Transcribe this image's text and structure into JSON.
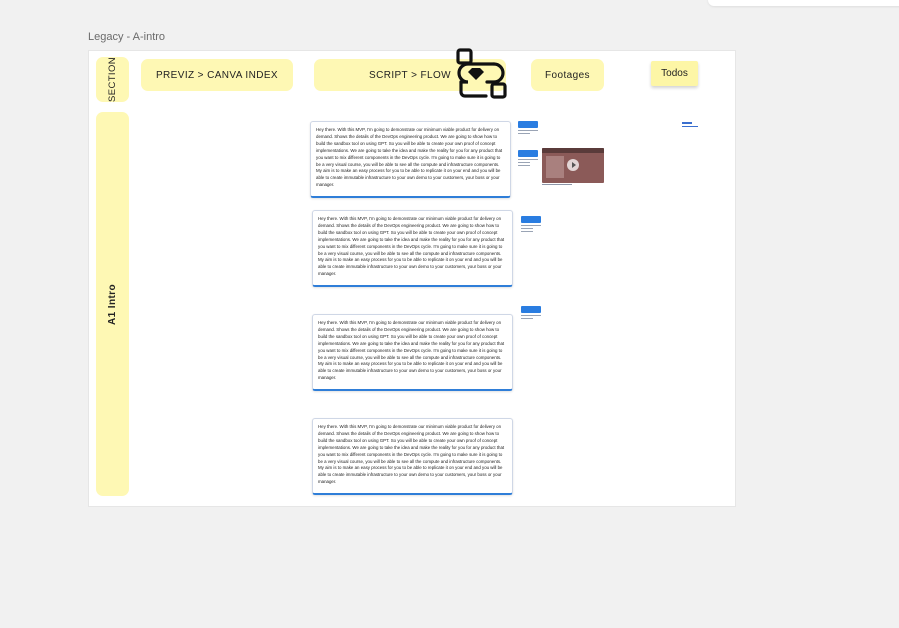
{
  "board": {
    "title": "Legacy - A-intro"
  },
  "columns": {
    "section": "SECTION",
    "previz": "PREVIZ > CANVA INDEX",
    "script": "SCRIPT > FLOW",
    "footages": "Footages",
    "todos": "Todos"
  },
  "rows": {
    "a1": "A1 Intro"
  },
  "script_cards": [
    {
      "text": "Hey there. With this MVP, I'm going to demonstrate our minimum viable product for delivery on demand. Shows the details of the DevOps engineering product. We are going to show how to build the sandbox tool on using GPT. So you will be able to create your own proof of concept implementations. We are going to take the idea and make the reality for you for any product that you want to mix different components in the DevOps cycle. I'm going to make sure it is going to be a very visual course, you will be able to see all the compute and infrastructure components. My aim is to make an easy process for you to be able to replicate it on your end and you will be able to create immutable infrastructure to your own demo to your customers, your boss or your manager."
    },
    {
      "text": "Hey there. With this MVP, I'm going to demonstrate our minimum viable product for delivery on demand. Shows the details of the DevOps engineering product. We are going to show how to build the sandbox tool on using GPT. So you will be able to create your own proof of concept implementations. We are going to take the idea and make the reality for you for any product that you want to mix different components in the DevOps cycle. I'm going to make sure it is going to be a very visual course, you will be able to see all the compute and infrastructure components. My aim is to make an easy process for you to be able to replicate it on your end and you will be able to create immutable infrastructure to your own demo to your customers, your boss or your manager."
    },
    {
      "text": "Hey there. With this MVP, I'm going to demonstrate our minimum viable product for delivery on demand. Shows the details of the DevOps engineering product. We are going to show how to build the sandbox tool on using GPT. So you will be able to create your own proof of concept implementations. We are going to take the idea and make the reality for you for any product that you want to mix different components in the DevOps cycle. I'm going to make sure it is going to be a very visual course, you will be able to see all the compute and infrastructure components. My aim is to make an easy process for you to be able to replicate it on your end and you will be able to create immutable infrastructure to your own demo to your customers, your boss or your manager."
    },
    {
      "text": "Hey there. With this MVP, I'm going to demonstrate our minimum viable product for delivery on demand. Shows the details of the DevOps engineering product. We are going to show how to build the sandbox tool on using GPT. So you will be able to create your own proof of concept implementations. We are going to take the idea and make the reality for you for any product that you want to mix different components in the DevOps cycle. I'm going to make sure it is going to be a very visual course, you will be able to see all the compute and infrastructure components. My aim is to make an easy process for you to be able to replicate it on your end and you will be able to create immutable infrastructure to your own demo to your customers, your boss or your manager."
    }
  ],
  "icons": {
    "flow_plugin": "flow-plugin-icon",
    "play": "play-icon"
  },
  "colors": {
    "sticky": "#fef8b4",
    "card_accent": "#2f7ed8",
    "thumb_header": "#2a7de1"
  }
}
